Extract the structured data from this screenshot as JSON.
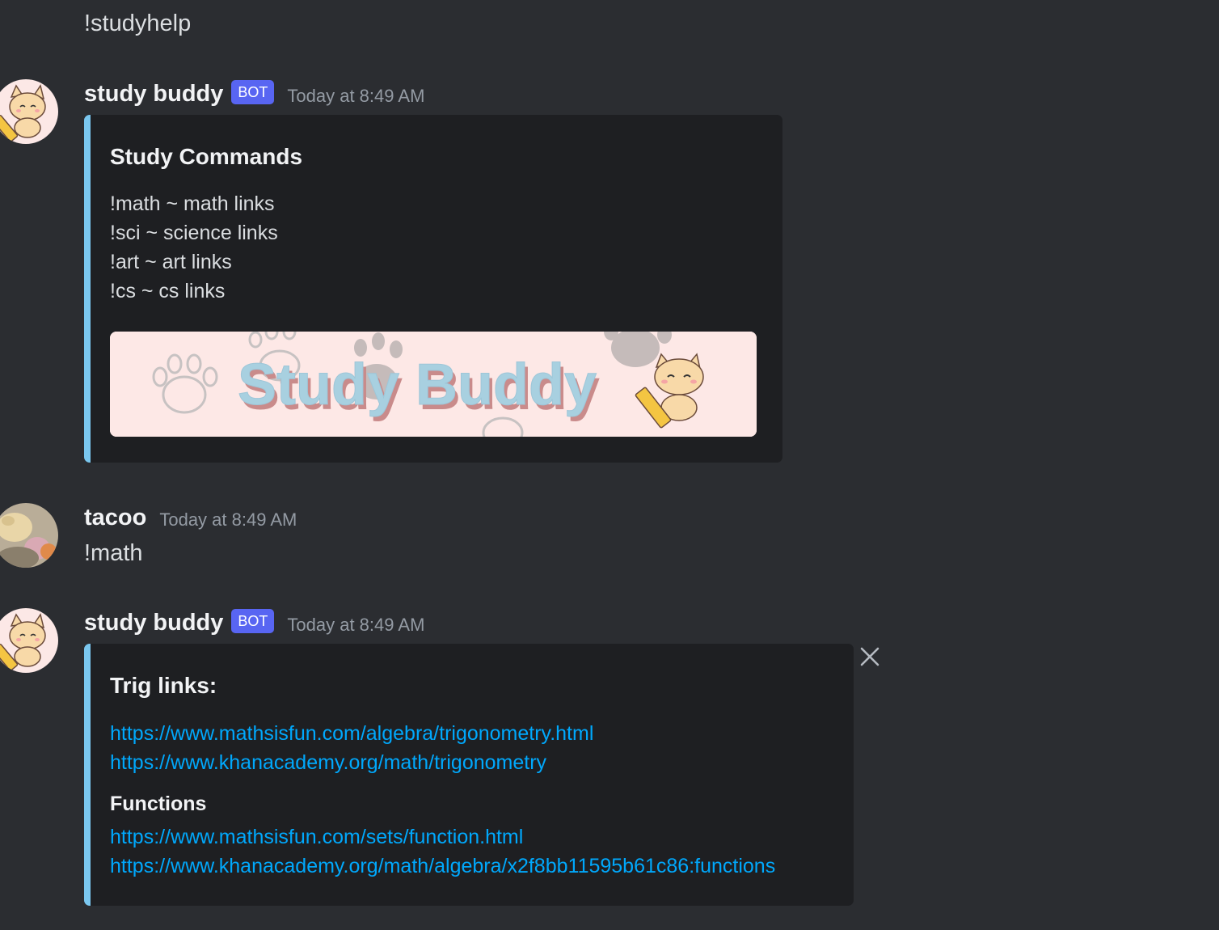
{
  "messages": {
    "first": {
      "text": "!studyhelp"
    },
    "bot_help": {
      "username": "study buddy",
      "badge": "BOT",
      "timestamp": "Today at 8:49 AM",
      "embed": {
        "title": "Study Commands",
        "lines": [
          "!math ~ math links",
          "!sci ~ science links",
          "!art ~ art links",
          "!cs ~ cs links"
        ],
        "banner_text": "Study Buddy"
      }
    },
    "user": {
      "username": "tacoo",
      "timestamp": "Today at 8:49 AM",
      "text": "!math"
    },
    "bot_math": {
      "username": "study buddy",
      "badge": "BOT",
      "timestamp": "Today at 8:49 AM",
      "embed": {
        "title": "Trig links:",
        "trig_links": [
          "https://www.mathsisfun.com/algebra/trigonometry.html",
          "https://www.khanacademy.org/math/trigonometry"
        ],
        "field_name": "Functions",
        "function_links": [
          "https://www.mathsisfun.com/sets/function.html",
          "https://www.khanacademy.org/math/algebra/x2f8bb11595b61c86:functions"
        ]
      }
    }
  },
  "colors": {
    "background": "#2b2d31",
    "embed_bg": "#1e1f22",
    "embed_border": "#7ac7ef",
    "link": "#00a8fc",
    "bot_badge": "#5865f2"
  },
  "icons": {
    "close": "close-icon",
    "bot_avatar": "cat-with-pencil-avatar",
    "user_avatar": "animals-avatar",
    "banner_paw": "paw-print-icon"
  }
}
